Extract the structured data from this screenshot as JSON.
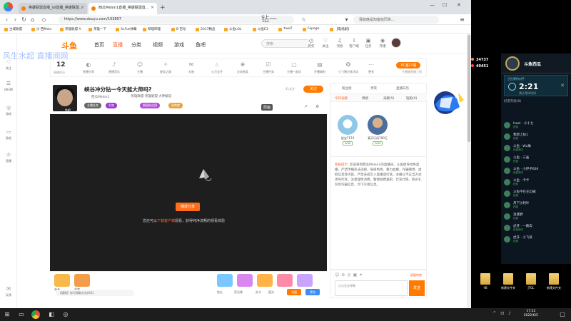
{
  "browser": {
    "tabs": [
      {
        "label": "英雄联盟直播_lol直播_英雄联盟..."
      },
      {
        "label": "西瓜Melon1直播_英雄联盟直..."
      }
    ],
    "new_tab": "+",
    "url": "https://www.douyu.com/103897",
    "search_placeholder": "我如晚是知客给同世..."
  },
  "bookmarks": [
    "主城联盟",
    "沙 西Melo",
    "英雄联盟 A",
    "英雄一下",
    "AcFun弹幕",
    "哔哩哔哩",
    "B 百号",
    "2017精品",
    "斗鱼LOL",
    "斗鱼E3",
    "XwxZ",
    "Fepego",
    "【电视剧】"
  ],
  "site_left": [
    {
      "label": "关注"
    },
    {
      "label": "排行榜"
    },
    {
      "label": "游戏"
    },
    {
      "label": "鱼吧"
    },
    {
      "label": "直播"
    },
    {
      "label": "反馈"
    }
  ],
  "site_header": {
    "logo": "斗鱼",
    "nav": [
      "首页",
      "直播",
      "分类",
      "视频",
      "游戏",
      "鱼吧"
    ],
    "search_placeholder": "搜索",
    "icons": [
      "历史",
      "关注",
      "消息",
      "客户端",
      "任务",
      "开播"
    ]
  },
  "watermark": {
    "left": "风生水起 直播间网",
    "top": "钻一"
  },
  "catbar": {
    "number": "12",
    "number_label": "直播积分",
    "items": [
      "直播分享",
      "直播音乐",
      "主播",
      "星际之路",
      "礼物",
      "火力全开",
      "全站抽奖",
      "主播任务",
      "主播一起玩",
      "开播福利",
      "小飞猪分享活动",
      "更多"
    ],
    "pc_label": "PC客户端",
    "pc_sub": "主播端直播上线"
  },
  "room": {
    "title": "峡谷冲分钻一今天能大师吗?",
    "avatar_name": "鱼吧",
    "meta1": "·英雄联盟·英雄联盟·大神解说",
    "meta2": "西瓜Melon1",
    "follow_count": "41关注",
    "follow_label": "关注",
    "pills": [
      "主播任务",
      "礼物",
      "超级粉丝团",
      "贵宾席"
    ],
    "quality": "原画"
  },
  "video": {
    "play_label": "播放分享",
    "msg_prefix": "您还可以",
    "msg_highlight": "下载客户端",
    "msg_suffix": "观看，获得纯净流畅的观看体验"
  },
  "giftbar": {
    "notice": "【通知】你可领取礼包(0/1)",
    "labels": [
      "鱼丸",
      "荧光棒",
      "办卡",
      "星光",
      "亲亲",
      "香吻"
    ],
    "btn1": "充值",
    "btn2": "背包"
  },
  "rank": {
    "tabs": [
      "粉丝榜",
      "贵宾",
      "直播日历"
    ],
    "headers": [
      "今日贡献",
      "周榜",
      "贡献(5)",
      "钻粉(0)"
    ],
    "users": [
      {
        "name": "鲨宝7174",
        "level": "LV46"
      },
      {
        "name": "真天行风700万",
        "level": "LV40"
      }
    ]
  },
  "chat": {
    "sys_tag": "系统提示:",
    "sys_msg": "欢迎来到西瓜Melon1的直播间。斗鱼倡导绿色直播，严禁传播违法违规、低俗色情、暴力血腥、诈骗赌博、虚假信息等内容。严禁未成年人直播或打赏。主播以不正当方式诱导打赏，注意理性消费。警惕招聘兼职、代充代练、购买礼包等诈骗信息，勿下交易信息。",
    "input_placeholder": "点击发送弹幕",
    "send_label": "发送",
    "mode_label": "屏蔽特效"
  },
  "game": {
    "kills_a": "34737",
    "kills_b": "40451",
    "name": "斗鱼西瓜",
    "timer_title": "正在等待对手",
    "clock": "2:21",
    "timer_sub": "预计等待时间",
    "list_title": "好友列表(8)",
    "friends": [
      {
        "name": "hwei · 小十七",
        "status": "在线"
      },
      {
        "name": "我想上钻1",
        "status": "在线"
      },
      {
        "name": "斗鱼 · Wu琳",
        "status": "在游戏中"
      },
      {
        "name": "斗鱼 · 三画",
        "status": "在线"
      },
      {
        "name": "斗鱼 · 小伊子666",
        "status": "在游戏中"
      },
      {
        "name": "斗鱼 · 卡卡",
        "status": "在线"
      },
      {
        "name": "斗鱼不在王幻磁",
        "status": "在线"
      },
      {
        "name": "月下沙利叶",
        "status": "在线"
      },
      {
        "name": "消遣野",
        "status": "在线"
      },
      {
        "name": "虎牙 · 一路奔",
        "status": "在游戏中"
      },
      {
        "name": "虎牙 · 小飞侠",
        "status": "在线"
      }
    ]
  },
  "desktop": [
    "YB",
    "新建文件夹",
    "JTGL",
    "新建文件夹"
  ],
  "taskbar": {
    "time": "17:22",
    "date": "2022/6/5"
  },
  "colors": {
    "accent": "#ff7a00",
    "page_bg": "#ffffff",
    "video_bg": "#1e1e1e"
  }
}
